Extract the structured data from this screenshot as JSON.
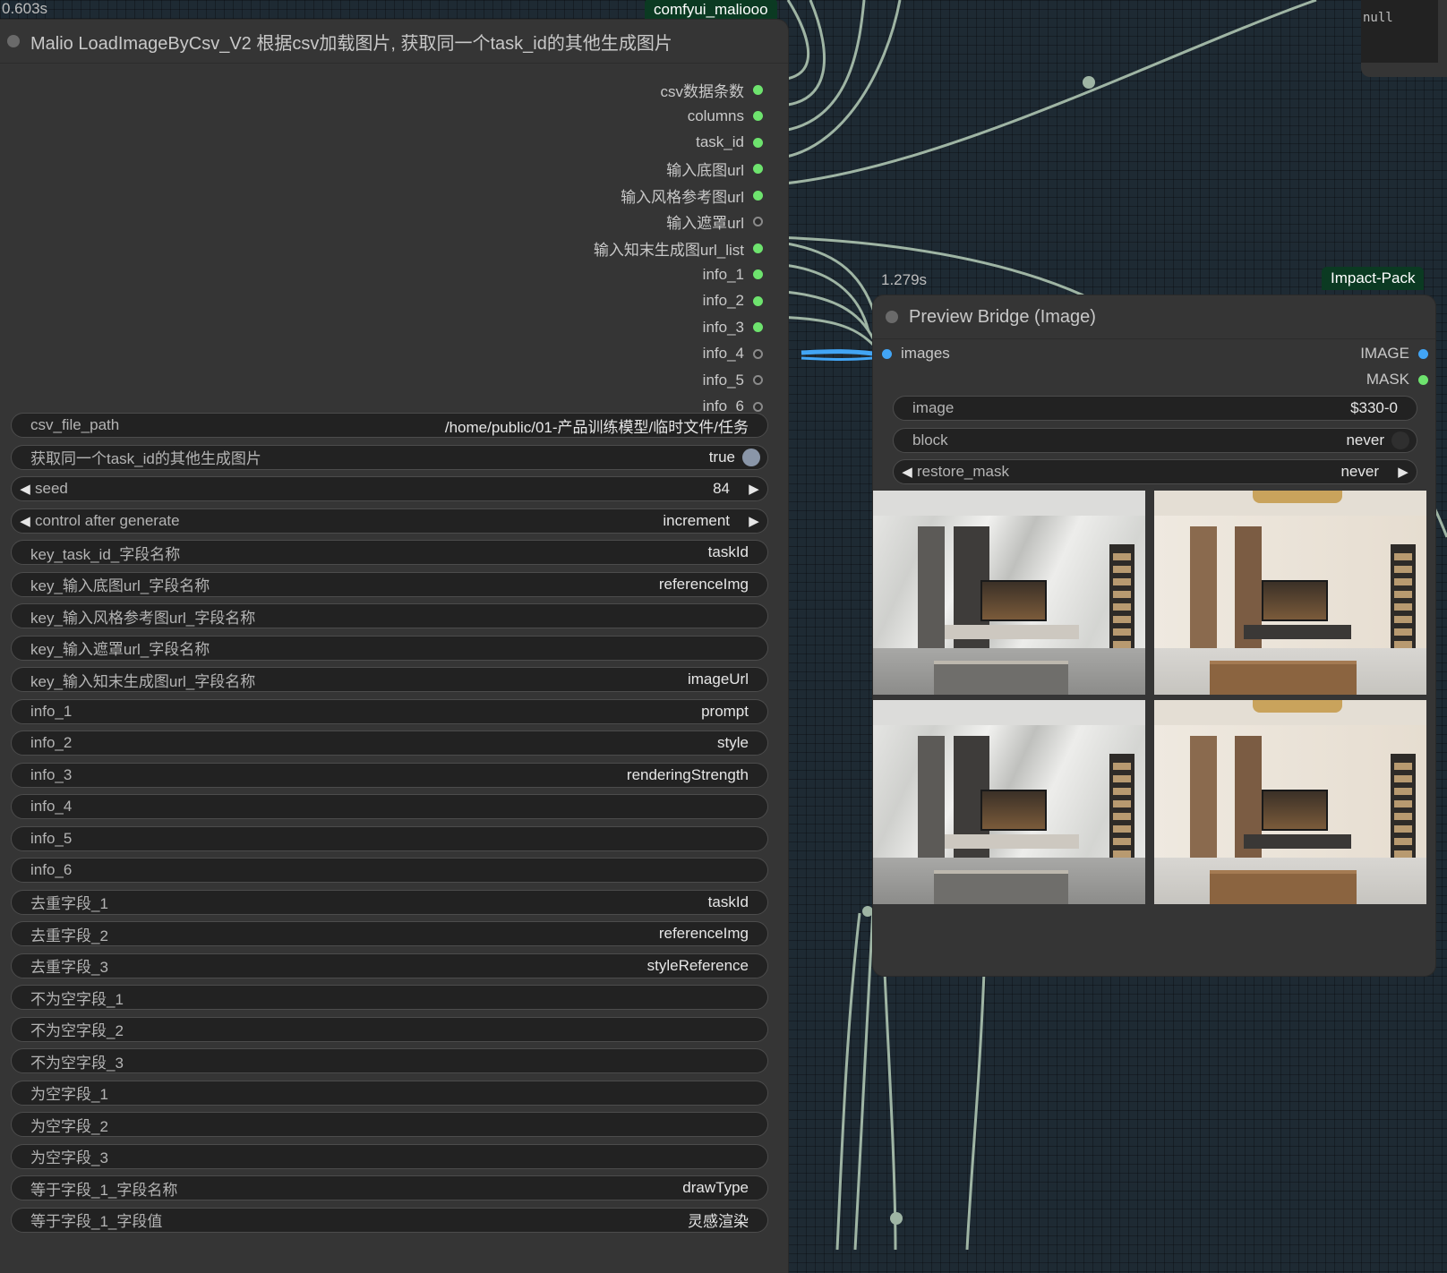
{
  "canvas": {
    "null_box_text": "null"
  },
  "load_node": {
    "time": "0.603s",
    "tag": "comfyui_maliooo",
    "title": "Malio LoadImageByCsv_V2 根据csv加载图片, 获取同一个task_id的其他生成图片",
    "outputs": [
      {
        "label": "csv数据条数",
        "connected": true
      },
      {
        "label": "columns",
        "connected": true
      },
      {
        "label": "task_id",
        "connected": true
      },
      {
        "label": "输入底图url",
        "connected": true
      },
      {
        "label": "输入风格参考图url",
        "connected": true
      },
      {
        "label": "输入遮罩url",
        "connected": false
      },
      {
        "label": "输入知末生成图url_list",
        "connected": true
      },
      {
        "label": "info_1",
        "connected": true
      },
      {
        "label": "info_2",
        "connected": true
      },
      {
        "label": "info_3",
        "connected": true
      },
      {
        "label": "info_4",
        "connected": false
      },
      {
        "label": "info_5",
        "connected": false
      },
      {
        "label": "info_6",
        "connected": false
      }
    ],
    "widgets": [
      {
        "label": "csv_file_path",
        "value": "/home/public/01-产品训练模型/临时文件/任务",
        "kind": "text"
      },
      {
        "label": "获取同一个task_id的其他生成图片",
        "value": "true",
        "kind": "toggle"
      },
      {
        "label": "seed",
        "value": "84",
        "kind": "number"
      },
      {
        "label": "control after generate",
        "value": "increment",
        "kind": "combo"
      },
      {
        "label": "key_task_id_字段名称",
        "value": "taskId",
        "kind": "text"
      },
      {
        "label": "key_输入底图url_字段名称",
        "value": "referenceImg",
        "kind": "text"
      },
      {
        "label": "key_输入风格参考图url_字段名称",
        "value": "",
        "kind": "text"
      },
      {
        "label": "key_输入遮罩url_字段名称",
        "value": "",
        "kind": "text"
      },
      {
        "label": "key_输入知末生成图url_字段名称",
        "value": "imageUrl",
        "kind": "text"
      },
      {
        "label": "info_1",
        "value": "prompt",
        "kind": "text"
      },
      {
        "label": "info_2",
        "value": "style",
        "kind": "text"
      },
      {
        "label": "info_3",
        "value": "renderingStrength",
        "kind": "text"
      },
      {
        "label": "info_4",
        "value": "",
        "kind": "text"
      },
      {
        "label": "info_5",
        "value": "",
        "kind": "text"
      },
      {
        "label": "info_6",
        "value": "",
        "kind": "text"
      },
      {
        "label": "去重字段_1",
        "value": "taskId",
        "kind": "text"
      },
      {
        "label": "去重字段_2",
        "value": "referenceImg",
        "kind": "text"
      },
      {
        "label": "去重字段_3",
        "value": "styleReference",
        "kind": "text"
      },
      {
        "label": "不为空字段_1",
        "value": "",
        "kind": "text"
      },
      {
        "label": "不为空字段_2",
        "value": "",
        "kind": "text"
      },
      {
        "label": "不为空字段_3",
        "value": "",
        "kind": "text"
      },
      {
        "label": "为空字段_1",
        "value": "",
        "kind": "text"
      },
      {
        "label": "为空字段_2",
        "value": "",
        "kind": "text"
      },
      {
        "label": "为空字段_3",
        "value": "",
        "kind": "text"
      },
      {
        "label": "等于字段_1_字段名称",
        "value": "drawType",
        "kind": "text"
      },
      {
        "label": "等于字段_1_字段值",
        "value": "灵感渲染",
        "kind": "text"
      }
    ]
  },
  "preview_node": {
    "time": "1.279s",
    "tag": "Impact-Pack",
    "title": "Preview Bridge (Image)",
    "input": {
      "label": "images"
    },
    "outputs": [
      {
        "label": "IMAGE",
        "color": "blue"
      },
      {
        "label": "MASK",
        "color": "green"
      }
    ],
    "widgets": [
      {
        "label": "image",
        "value": "$330-0",
        "kind": "text"
      },
      {
        "label": "block",
        "value": "never",
        "kind": "toggle"
      },
      {
        "label": "restore_mask",
        "value": "never",
        "kind": "combo"
      }
    ],
    "images": [
      {
        "theme": "marble"
      },
      {
        "theme": "wood"
      },
      {
        "theme": "marble"
      },
      {
        "theme": "wood"
      }
    ]
  },
  "colors": {
    "canvas_bg": "#1e2a33",
    "node_bg": "#353535",
    "widget_bg": "#222222",
    "link": "#9fb5a4",
    "link_blue": "#42a5f5",
    "slot_on": "#6ee36e",
    "tag_bg": "#0b3a22"
  }
}
